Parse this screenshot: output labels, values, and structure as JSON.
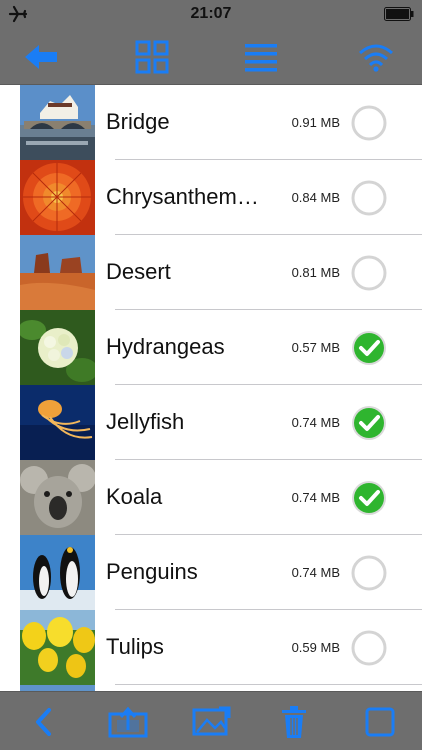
{
  "status_bar": {
    "time": "21:07"
  },
  "colors": {
    "toolbar": "#6e6e6e",
    "accent": "#1a7df5",
    "check_green": "#2fb52f"
  },
  "top_toolbar": {
    "icons": [
      "back-arrow-icon",
      "grid-view-icon",
      "list-view-icon",
      "wifi-icon"
    ]
  },
  "files": [
    {
      "name": "Bridge",
      "size": "0.91 MB",
      "selected": false
    },
    {
      "name": "Chrysanthem…",
      "size": "0.84 MB",
      "selected": false
    },
    {
      "name": "Desert",
      "size": "0.81 MB",
      "selected": false
    },
    {
      "name": "Hydrangeas",
      "size": "0.57 MB",
      "selected": true
    },
    {
      "name": "Jellyfish",
      "size": "0.74 MB",
      "selected": true
    },
    {
      "name": "Koala",
      "size": "0.74 MB",
      "selected": true
    },
    {
      "name": "Penguins",
      "size": "0.74 MB",
      "selected": false
    },
    {
      "name": "Tulips",
      "size": "0.59 MB",
      "selected": false
    }
  ],
  "bottom_toolbar": {
    "icons": [
      "chevron-left-icon",
      "share-icon",
      "photo-import-icon",
      "trash-icon",
      "select-all-icon"
    ]
  }
}
